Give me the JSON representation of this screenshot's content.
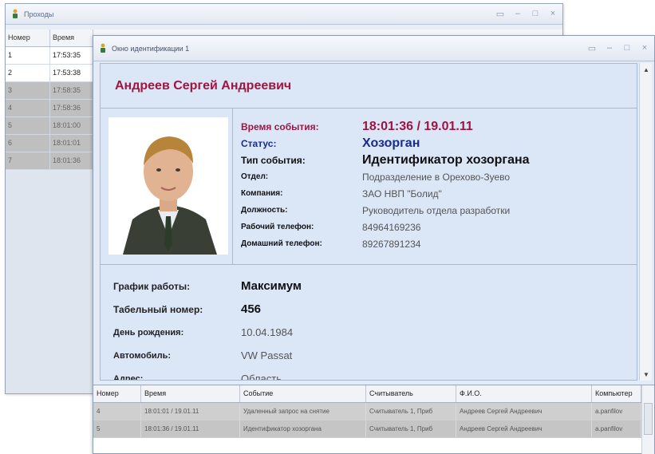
{
  "back_window": {
    "title": "Проходы",
    "columns": {
      "no": "Номер",
      "time": "Время"
    },
    "rows": [
      {
        "no": "1",
        "time": "17:53:35",
        "selected": false
      },
      {
        "no": "2",
        "time": "17:53:38",
        "selected": false
      },
      {
        "no": "3",
        "time": "17:58:35",
        "selected": true
      },
      {
        "no": "4",
        "time": "17:58:36",
        "selected": true
      },
      {
        "no": "5",
        "time": "18:01:00",
        "selected": true
      },
      {
        "no": "6",
        "time": "18:01:01",
        "selected": true
      },
      {
        "no": "7",
        "time": "18:01:36",
        "selected": true
      }
    ]
  },
  "front_window": {
    "title": "Окно идентификации 1",
    "person_name": "Андреев Сергей Андреевич",
    "photo_icon": "person-photo",
    "event": {
      "time_label": "Время события:",
      "time_value": "18:01:36 / 19.01.11",
      "status_label": "Статус:",
      "status_value": "Хозорган",
      "type_label": "Тип события:",
      "type_value": "Идентификатор хозоргана",
      "dept_label": "Отдел:",
      "dept_value": "Подразделение в Орехово-Зуево",
      "company_label": "Компания:",
      "company_value": "ЗАО НВП \"Болид\"",
      "position_label": "Должность:",
      "position_value": "Руководитель отдела разработки",
      "work_phone_label": "Рабочий телефон:",
      "work_phone_value": "84964169236",
      "home_phone_label": "Домашний телефон:",
      "home_phone_value": "89267891234"
    },
    "details": {
      "schedule_label": "График работы:",
      "schedule_value": "Максимум",
      "tab_label": "Табельный номер:",
      "tab_value": "456",
      "birthday_label": "День рождения:",
      "birthday_value": "10.04.1984",
      "car_label": "Автомобиль:",
      "car_value": "VW Passat",
      "address_label": "Адрес:",
      "address_value": "Область"
    },
    "grid": {
      "headers": {
        "no": "Номер",
        "time": "Время",
        "event": "Событие",
        "reader": "Считыватель",
        "fio": "Ф.И.О.",
        "computer": "Компьютер"
      },
      "rows": [
        {
          "no": "4",
          "time": "18:01:01 / 19.01.11",
          "event": "Удаленный запрос на снятие",
          "reader": "Считыватель 1, Приб",
          "fio": "Андреев Сергей Андреевич",
          "computer": "a.panfilov"
        },
        {
          "no": "5",
          "time": "18:01:36 / 19.01.11",
          "event": "Идентификатор хозоргана",
          "reader": "Считыватель 1, Приб",
          "fio": "Андреев Сергей Андреевич",
          "computer": "a.panfilov"
        }
      ]
    }
  },
  "colors": {
    "accent_red": "#a01540",
    "status_blue": "#1a2c8c",
    "panel_bg": "#dbe6f7"
  }
}
